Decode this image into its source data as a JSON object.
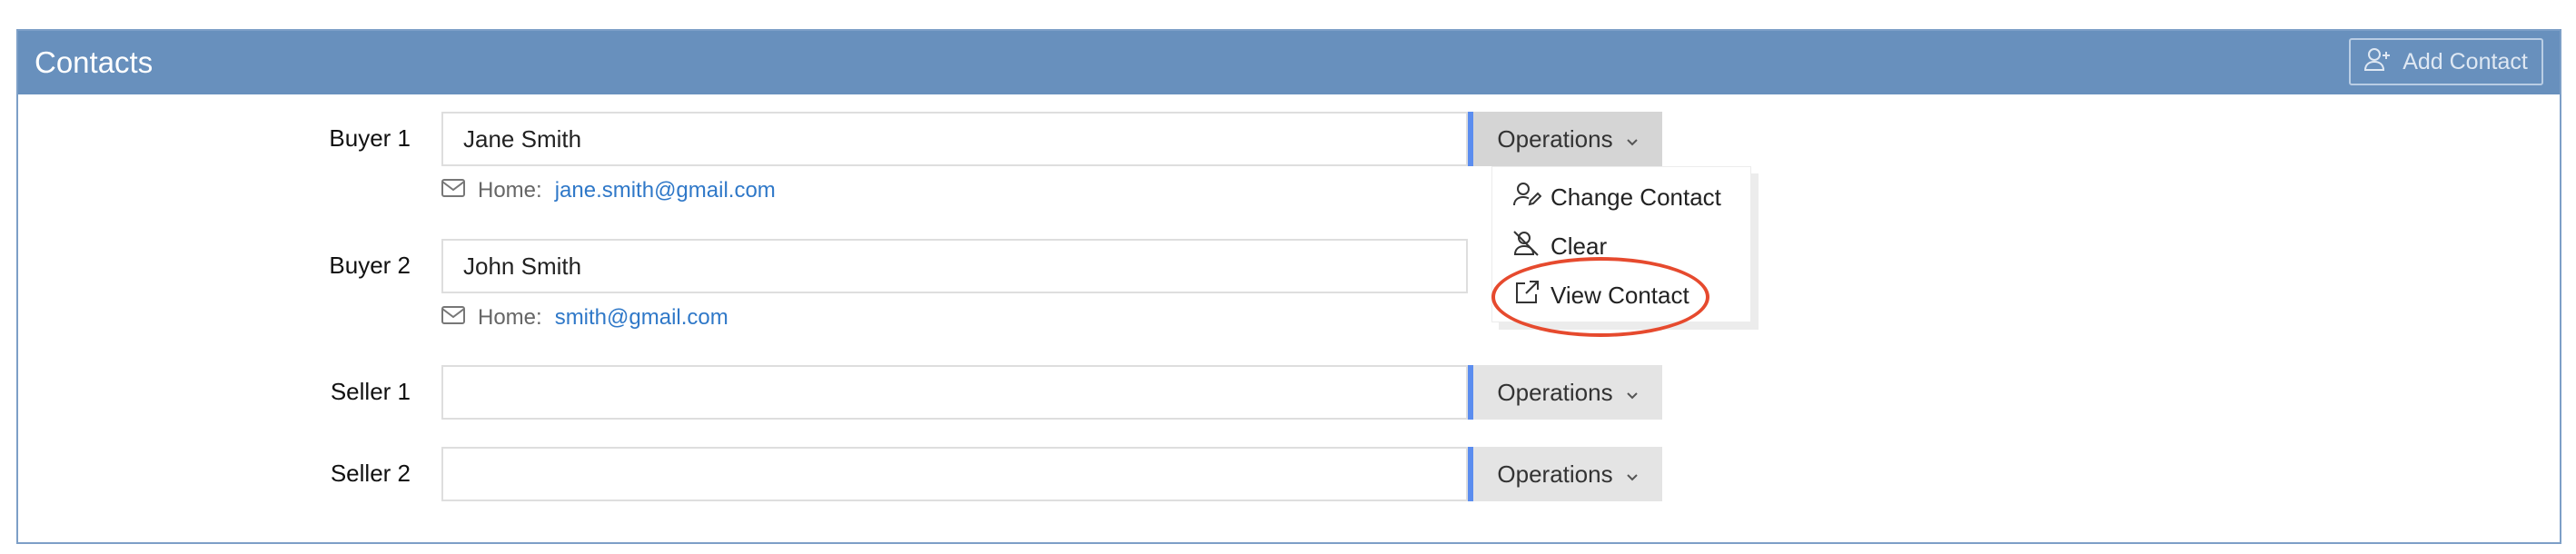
{
  "panel": {
    "title": "Contacts",
    "add_contact_label": "Add Contact"
  },
  "rows": [
    {
      "label": "Buyer 1",
      "value": "Jane Smith",
      "email_prefix": "Home:",
      "email": "jane.smith@gmail.com",
      "operations_label": "Operations"
    },
    {
      "label": "Buyer 2",
      "value": "John Smith",
      "email_prefix": "Home:",
      "email": "smith@gmail.com"
    },
    {
      "label": "Seller 1",
      "value": "",
      "operations_label": "Operations"
    },
    {
      "label": "Seller 2",
      "value": "",
      "operations_label": "Operations"
    }
  ],
  "operations_menu": {
    "items": [
      {
        "label": "Change Contact",
        "icon": "user-edit-icon"
      },
      {
        "label": "Clear",
        "icon": "user-remove-icon"
      },
      {
        "label": "View Contact",
        "icon": "external-link-icon"
      }
    ]
  },
  "colors": {
    "header_bg": "#6890bd",
    "accent_bar": "#5b8def",
    "link": "#2f78c8",
    "highlight": "#e64a2e"
  }
}
